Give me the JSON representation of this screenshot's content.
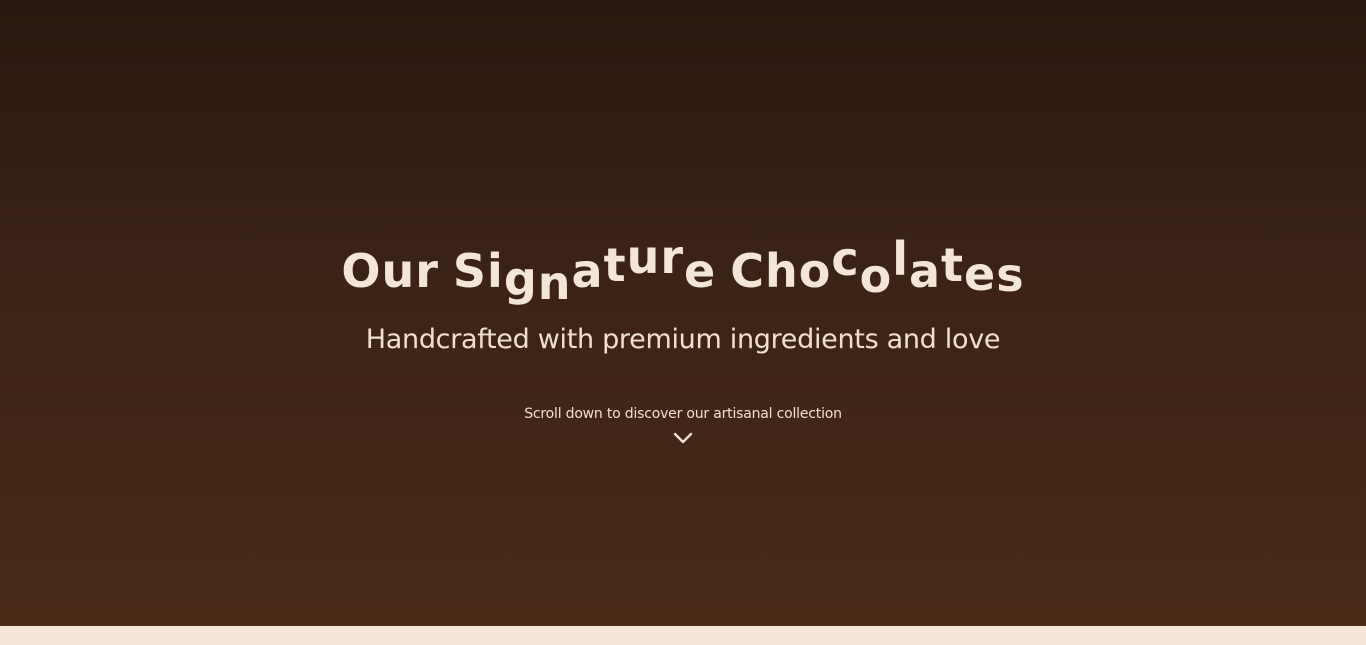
{
  "hero": {
    "title": "Our Signature Chocolates",
    "subtitle": "Handcrafted with premium ingredients and love",
    "scroll_hint": "Scroll down to discover our artisanal collection",
    "scroll_icon": "chevron-down-icon"
  },
  "colors": {
    "hero_top": "#2a1810",
    "hero_bottom": "#4a2b18",
    "text": "#f3e6d8",
    "below_fold": "#f3e6d8"
  }
}
